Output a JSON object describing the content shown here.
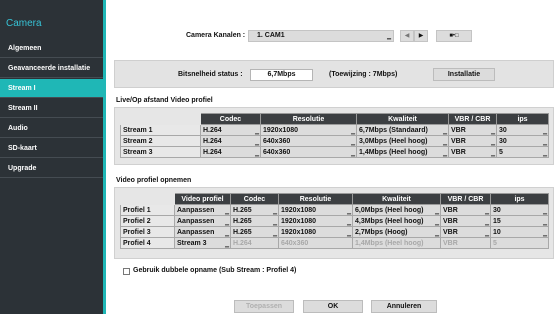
{
  "sidebar": {
    "title": "Camera",
    "items": [
      {
        "label": "Algemeen"
      },
      {
        "label": "Geavanceerde installatie"
      },
      {
        "label": "Stream I"
      },
      {
        "label": "Stream II"
      },
      {
        "label": "Audio"
      },
      {
        "label": "SD-kaart"
      },
      {
        "label": "Upgrade"
      }
    ],
    "active_index": 2,
    "accent_color": "#1fb7b6"
  },
  "camera": {
    "label": "Camera Kanalen :",
    "value": "1. CAM1",
    "prev_icon": "arrow-left-icon",
    "next_icon": "arrow-right-icon",
    "copy_icon": "copy-settings-icon",
    "copy_glyph": "■•□"
  },
  "bitrate": {
    "label": "Bitsnelheid status :",
    "value": "6,7Mbps",
    "allocation": "(Toewijzing : 7Mbps)",
    "install_button": "Installatie"
  },
  "live_profile": {
    "title": "Live/Op afstand Video profiel",
    "headers": [
      "",
      "Codec",
      "Resolutie",
      "Kwaliteit",
      "VBR / CBR",
      "ips"
    ],
    "rows": [
      {
        "name": "Stream 1",
        "codec": "H.264",
        "resolution": "1920x1080",
        "quality": "6,7Mbps (Standaard)",
        "vbr": "VBR",
        "ips": "30"
      },
      {
        "name": "Stream 2",
        "codec": "H.264",
        "resolution": "640x360",
        "quality": "3,0Mbps (Heel hoog)",
        "vbr": "VBR",
        "ips": "30"
      },
      {
        "name": "Stream 3",
        "codec": "H.264",
        "resolution": "640x360",
        "quality": "1,4Mbps (Heel hoog)",
        "vbr": "VBR",
        "ips": "5"
      }
    ]
  },
  "record_profile": {
    "title": "Video profiel opnemen",
    "headers": [
      "",
      "Video profiel",
      "Codec",
      "Resolutie",
      "Kwaliteit",
      "VBR / CBR",
      "ips"
    ],
    "rows": [
      {
        "name": "Profiel 1",
        "profile": "Aanpassen",
        "codec": "H.265",
        "resolution": "1920x1080",
        "quality": "6,0Mbps (Heel hoog)",
        "vbr": "VBR",
        "ips": "30",
        "disabled": false
      },
      {
        "name": "Profiel 2",
        "profile": "Aanpassen",
        "codec": "H.265",
        "resolution": "1920x1080",
        "quality": "4,3Mbps (Heel hoog)",
        "vbr": "VBR",
        "ips": "15",
        "disabled": false
      },
      {
        "name": "Profiel 3",
        "profile": "Aanpassen",
        "codec": "H.265",
        "resolution": "1920x1080",
        "quality": "2,7Mbps (Hoog)",
        "vbr": "VBR",
        "ips": "10",
        "disabled": false
      },
      {
        "name": "Profiel 4",
        "profile": "Stream 3",
        "codec": "H.264",
        "resolution": "640x360",
        "quality": "1,4Mbps (Heel hoog)",
        "vbr": "VBR",
        "ips": "5",
        "disabled": true
      }
    ]
  },
  "dual_record": {
    "checked": false,
    "label": "Gebruik dubbele opname  (Sub Stream : Profiel 4)"
  },
  "footer": {
    "apply": "Toepassen",
    "ok": "OK",
    "cancel": "Annuleren"
  }
}
